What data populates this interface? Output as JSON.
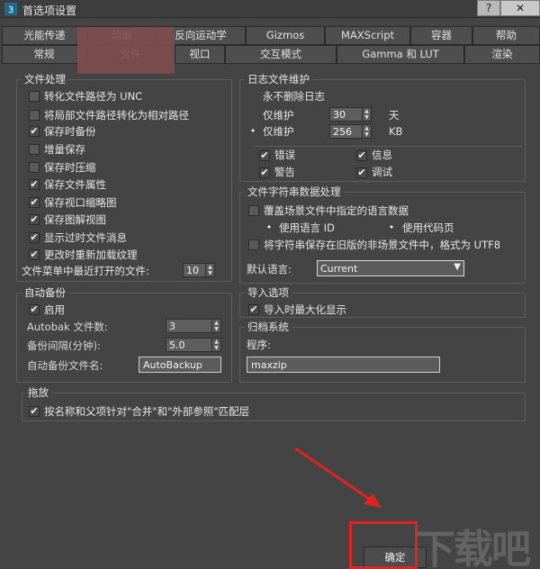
{
  "window": {
    "title": "首选项设置",
    "help_glyph": "?",
    "close_glyph": "✕"
  },
  "tabs_row1": [
    "光能传递",
    "动画",
    "反向运动学",
    "Gizmos",
    "MAXScript",
    "容器",
    "帮助"
  ],
  "tabs_row2": [
    "常规",
    "文件",
    "视口",
    "交互模式",
    "Gamma 和 LUT",
    "渲染"
  ],
  "file_handling": {
    "title": "文件处理",
    "items": [
      {
        "label": "转化文件路径为 UNC",
        "checked": false
      },
      {
        "label": "将局部文件路径转化为相对路径",
        "checked": false
      },
      {
        "label": "保存时备份",
        "checked": true
      },
      {
        "label": "增量保存",
        "checked": false
      },
      {
        "label": "保存时压缩",
        "checked": false
      },
      {
        "label": "保存文件属性",
        "checked": true
      },
      {
        "label": "保存视口缩略图",
        "checked": true
      },
      {
        "label": "保存图解视图",
        "checked": true
      },
      {
        "label": "显示过时文件消息",
        "checked": true
      },
      {
        "label": "更改时重新加载纹理",
        "checked": true
      }
    ],
    "recent_label": "文件菜单中最近打开的文件:",
    "recent_value": "10"
  },
  "log": {
    "title": "日志文件维护",
    "never_delete": "永不删除日志",
    "keep_days_label": "仅维护",
    "keep_days_value": "30",
    "keep_days_unit": "天",
    "keep_kb_label": "仅维护",
    "keep_kb_value": "256",
    "keep_kb_unit": "KB",
    "error": "错误",
    "info": "信息",
    "warning": "警告",
    "debug": "调试"
  },
  "strings": {
    "title": "文件字符串数据处理",
    "override_label": "覆盖场景文件中指定的语言数据",
    "use_lang_id": "使用语言 ID",
    "use_codepage": "使用代码页",
    "save_legacy": "将字符串保存在旧版的非场景文件中，格式为 UTF8",
    "default_lang_label": "默认语言:",
    "default_lang_value": "Current"
  },
  "autobackup": {
    "title": "自动备份",
    "enable": "启用",
    "count_label": "Autobak 文件数:",
    "count_value": "3",
    "interval_label": "备份间隔(分钟):",
    "interval_value": "5.0",
    "name_label": "自动备份文件名:",
    "name_value": "AutoBackup"
  },
  "import": {
    "title": "导入选项",
    "maximize": "导入时最大化显示"
  },
  "archive": {
    "title": "归档系统",
    "program_label": "程序:",
    "program_value": "maxzip"
  },
  "drag": {
    "title": "拖放",
    "match_label": "按名称和父项针对\"合并\"和\"外部参照\"匹配层"
  },
  "buttons": {
    "ok": "确定"
  },
  "icons": {
    "check": "✔",
    "radio_dot": "•",
    "dropdown": "▼",
    "spin_up": "▲",
    "spin_down": "▼"
  },
  "overlay": {
    "watermark": "下载吧"
  }
}
